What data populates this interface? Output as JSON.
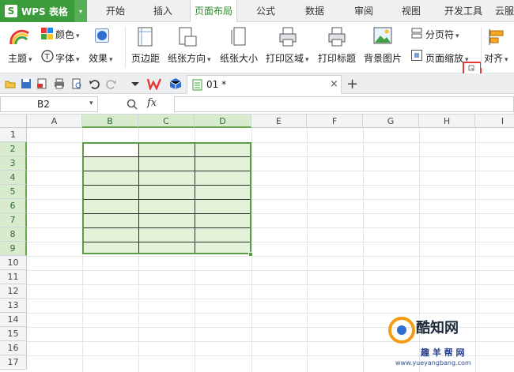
{
  "app": {
    "name": "WPS 表格",
    "logo_letter": "S",
    "arrow": "▾"
  },
  "menu": {
    "tabs": [
      {
        "label": "开始"
      },
      {
        "label": "插入"
      },
      {
        "label": "页面布局"
      },
      {
        "label": "公式"
      },
      {
        "label": "数据"
      },
      {
        "label": "审阅"
      },
      {
        "label": "视图"
      },
      {
        "label": "开发工具"
      },
      {
        "label": "云服"
      }
    ],
    "active_tab": "页面布局"
  },
  "ribbon": {
    "theme": "主题",
    "colors": "颜色",
    "font": "字体",
    "effects": "效果",
    "margins": "页边距",
    "orientation": "纸张方向",
    "size": "纸张大小",
    "print_area": "打印区域",
    "print_titles": "打印标题",
    "background": "背景图片",
    "page_break": "分页符",
    "page_scale": "页面缩放",
    "align": "对齐"
  },
  "doc_tab": {
    "name": "01 *",
    "close": "×",
    "add": "+"
  },
  "formula_bar": {
    "cell_ref": "B2",
    "fx": "fx"
  },
  "grid": {
    "columns": [
      "A",
      "B",
      "C",
      "D",
      "E",
      "F",
      "G",
      "H",
      "I"
    ],
    "rows": [
      "1",
      "2",
      "3",
      "4",
      "5",
      "6",
      "7",
      "8",
      "9",
      "10",
      "11",
      "12",
      "13",
      "14",
      "15",
      "16",
      "17"
    ],
    "selection": "B2:D9"
  },
  "watermark": {
    "brand": "酷知网",
    "sub": "趣 羊 帮 网",
    "url": "www.yueyangbang.com"
  },
  "colors": {
    "accent": "#3c9c3c",
    "selection_fill": "#e3f2d9",
    "selection_border": "#5c9c44"
  }
}
